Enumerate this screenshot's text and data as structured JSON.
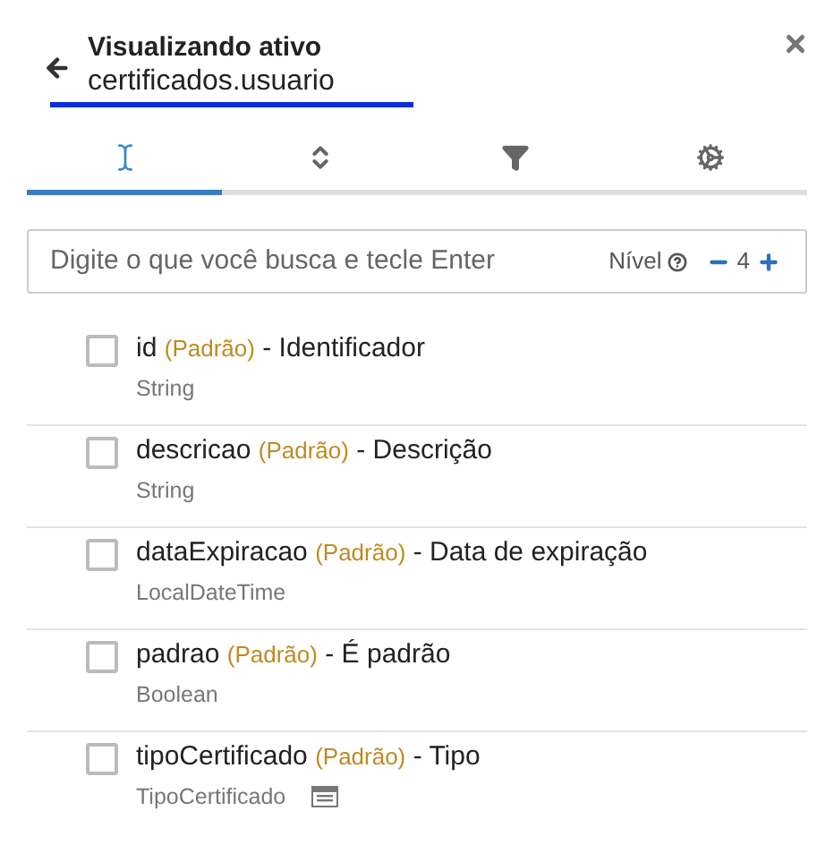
{
  "header": {
    "title": "Visualizando ativo",
    "subtitle": "certificados.usuario"
  },
  "tabs": [
    {
      "kind": "text",
      "selected": true
    },
    {
      "kind": "sort",
      "selected": false
    },
    {
      "kind": "filter",
      "selected": false
    },
    {
      "kind": "settings",
      "selected": false
    }
  ],
  "search": {
    "placeholder": "Digite o que você busca e tecle Enter",
    "level_label": "Nível",
    "level_value": "4"
  },
  "fields": [
    {
      "name": "id",
      "tag": "(Padrão)",
      "label": "- Identificador",
      "type": "String",
      "checked": false,
      "enum_icon": false
    },
    {
      "name": "descricao",
      "tag": "(Padrão)",
      "label": "- Descrição",
      "type": "String",
      "checked": false,
      "enum_icon": false
    },
    {
      "name": "dataExpiracao",
      "tag": "(Padrão)",
      "label": "- Data de expiração",
      "type": "LocalDateTime",
      "checked": false,
      "enum_icon": false
    },
    {
      "name": "padrao",
      "tag": "(Padrão)",
      "label": "- É padrão",
      "type": "Boolean",
      "checked": false,
      "enum_icon": false
    },
    {
      "name": "tipoCertificado",
      "tag": "(Padrão)",
      "label": "- Tipo",
      "type": "TipoCertificado",
      "checked": false,
      "enum_icon": true
    }
  ]
}
